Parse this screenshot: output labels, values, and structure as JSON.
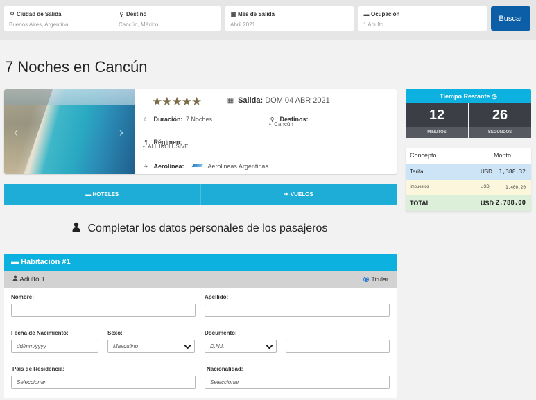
{
  "search": {
    "origin_label": "Ciudad de Salida",
    "origin_value": "Buenos Aires, Argentina",
    "destination_label": "Destino",
    "destination_value": "Cancún, México",
    "month_label": "Mes de Salida",
    "month_value": "Abril 2021",
    "occupancy_label": "Ocupación",
    "occupancy_value": "1 Adulto",
    "search_button": "Buscar"
  },
  "page_title": "7 Noches en Cancún",
  "package": {
    "stars": "★★★★★",
    "salida_label": "Salida:",
    "salida_value": "DOM 04 ABR 2021",
    "duracion_label": "Duración:",
    "duracion_value": "7 Noches",
    "destinos_label": "Destinos:",
    "destinos_items": [
      "Cancún"
    ],
    "regimen_label": "Régimen:",
    "regimen_items": [
      "ALL INCLUSIVE"
    ],
    "aerolinea_label": "Aerolínea:",
    "aerolinea_value": "Aerolineas Argentinas"
  },
  "tabs": [
    {
      "label": "HOTELES",
      "icon": "bed-icon"
    },
    {
      "label": "VUELOS",
      "icon": "plane-icon"
    }
  ],
  "section_heading": "Completar los datos personales de los pasajeros",
  "room": {
    "title": "Habitación #1",
    "adult_label": "Adulto 1",
    "titular_label": "Titular",
    "fields": {
      "nombre_label": "Nombre:",
      "apellido_label": "Apellido:",
      "fecha_label": "Fecha de Nacimiento:",
      "fecha_placeholder": "dd/mm/yyyy",
      "sexo_label": "Sexo:",
      "sexo_value": "Masculino",
      "documento_label": "Documento:",
      "documento_type": "D.N.I.",
      "pais_label": "País de Residencia:",
      "pais_value": "Seleccionar",
      "nacionalidad_label": "Nacionalidad:",
      "nacionalidad_value": "Seleccionar"
    }
  },
  "timer": {
    "title": "Tiempo Restante",
    "minutes": "12",
    "minutes_label": "MINUTOS",
    "seconds": "26",
    "seconds_label": "SEGUNDOS"
  },
  "prices": {
    "header_concept": "Concepto",
    "header_amount": "Monto",
    "rows": [
      {
        "concept": "Tarifa",
        "currency": "USD",
        "amount": "1,388.32"
      },
      {
        "concept": "Impuestos",
        "currency": "USD",
        "amount": "1,400.20"
      },
      {
        "concept": "TOTAL",
        "currency": "USD",
        "amount": "2,788.00"
      }
    ]
  },
  "colors": {
    "accent": "#0cb1e0",
    "button": "#0c5ea6",
    "timer_bg": "#3b3f45"
  }
}
